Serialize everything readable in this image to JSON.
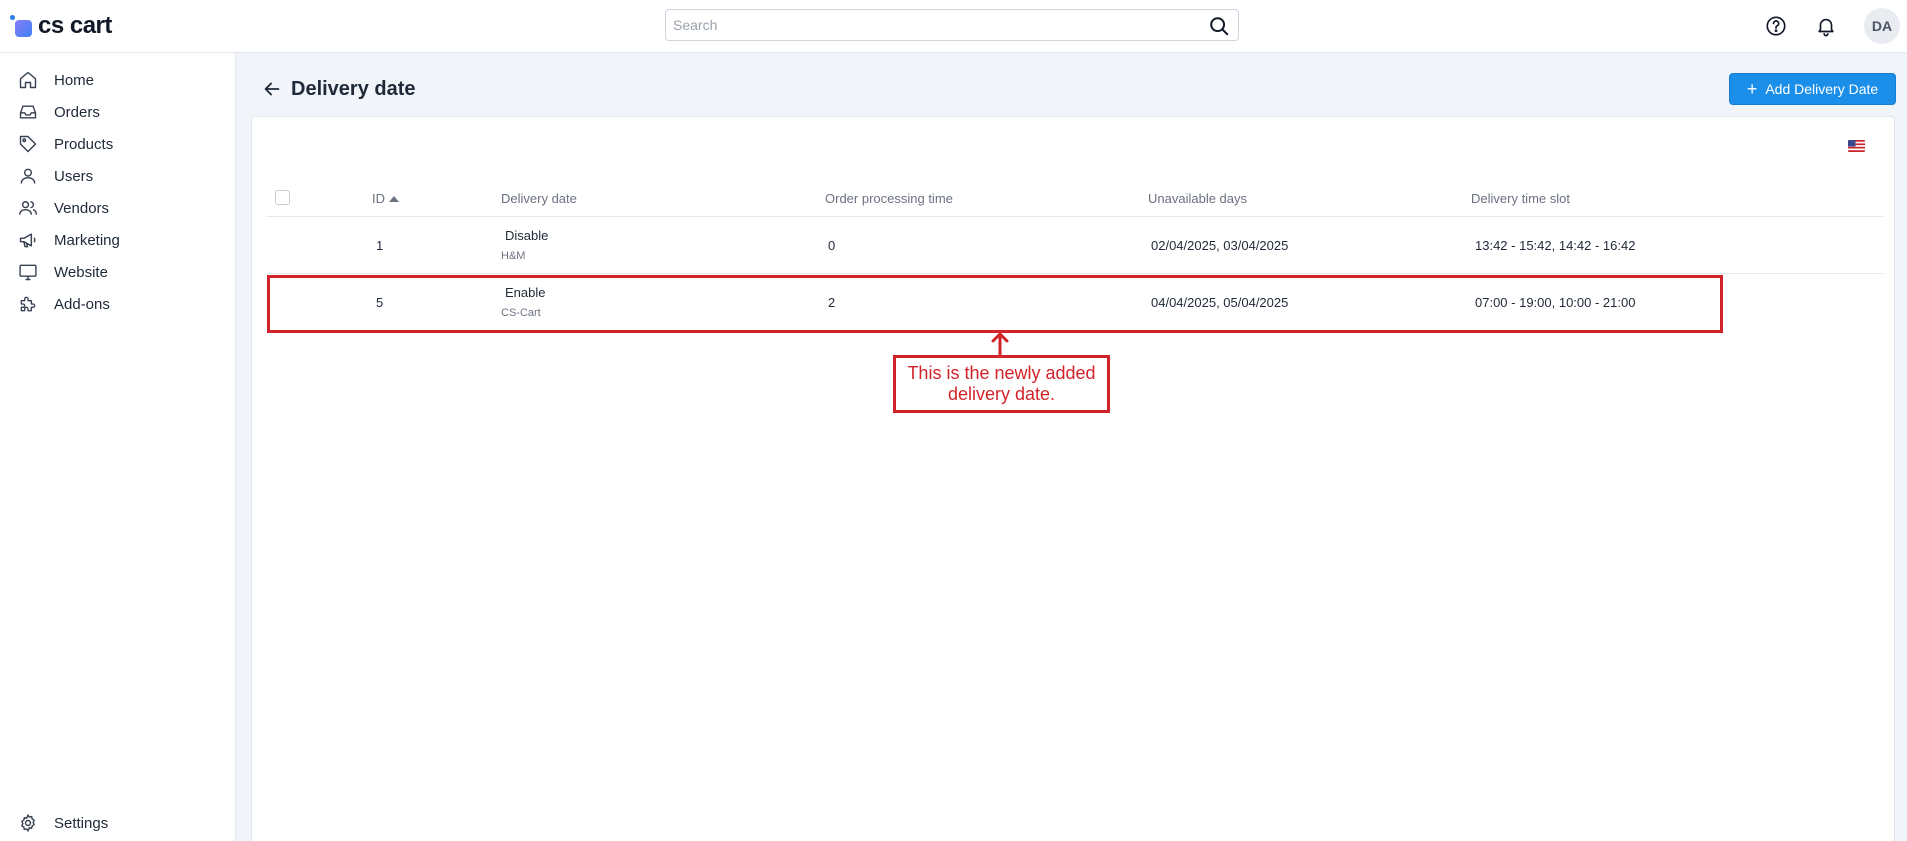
{
  "app": {
    "logo_text": "cs cart"
  },
  "header": {
    "search_placeholder": "Search",
    "avatar_initials": "DA"
  },
  "sidebar": {
    "items": [
      {
        "label": "Home",
        "icon": "home-icon"
      },
      {
        "label": "Orders",
        "icon": "inbox-icon"
      },
      {
        "label": "Products",
        "icon": "tag-icon"
      },
      {
        "label": "Users",
        "icon": "user-icon"
      },
      {
        "label": "Vendors",
        "icon": "users-icon"
      },
      {
        "label": "Marketing",
        "icon": "megaphone-icon"
      },
      {
        "label": "Website",
        "icon": "monitor-icon"
      },
      {
        "label": "Add-ons",
        "icon": "puzzle-icon"
      }
    ],
    "settings_label": "Settings"
  },
  "page": {
    "title": "Delivery date",
    "add_button_label": "Add Delivery Date"
  },
  "table": {
    "columns": {
      "id": "ID",
      "delivery_date": "Delivery date",
      "processing_time": "Order processing time",
      "unavailable_days": "Unavailable days",
      "time_slot": "Delivery time slot"
    },
    "rows": [
      {
        "id": "1",
        "status": "Disable",
        "vendor": "H&M",
        "processing_time": "0",
        "unavailable_days": "02/04/2025, 03/04/2025",
        "time_slot": "13:42 - 15:42, 14:42 - 16:42"
      },
      {
        "id": "5",
        "status": "Enable",
        "vendor": "CS-Cart",
        "processing_time": "2",
        "unavailable_days": "04/04/2025, 05/04/2025",
        "time_slot": "07:00 - 19:00, 10:00 - 21:00"
      }
    ]
  },
  "annotation": {
    "line1": "This is the newly added",
    "line2": "delivery date.",
    "color": "#d2232a"
  },
  "colors": {
    "accent": "#1a8ee8",
    "background": "#f1f4f9"
  }
}
